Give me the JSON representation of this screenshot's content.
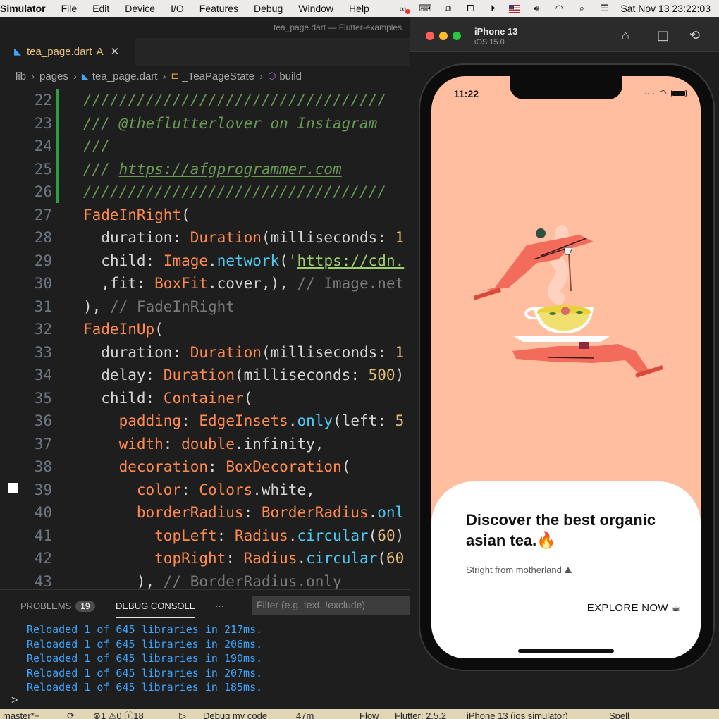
{
  "menubar": {
    "app": "Simulator",
    "menus": [
      "File",
      "Edit",
      "Device",
      "I/O",
      "Features",
      "Debug",
      "Window",
      "Help"
    ],
    "clock": "Sat Nov 13  23:22:03"
  },
  "vscode": {
    "window_title": "tea_page.dart — Flutter-examples",
    "tab": {
      "name": "tea_page.dart",
      "modifier": "A"
    },
    "breadcrumb": [
      "lib",
      "pages",
      "tea_page.dart",
      "_TeaPageState",
      "build"
    ],
    "line_numbers": [
      "22",
      "23",
      "24",
      "25",
      "26",
      "27",
      "28",
      "29",
      "30",
      "31",
      "32",
      "33",
      "34",
      "35",
      "36",
      "37",
      "38",
      "39",
      "40",
      "41",
      "42",
      "43"
    ],
    "panel": {
      "tabs": [
        "PROBLEMS",
        "DEBUG CONSOLE"
      ],
      "problems_count": "19",
      "more": "···",
      "filter_placeholder": "Filter (e.g. text, !exclude)",
      "console_lines": [
        "Reloaded 1 of 645 libraries in 217ms.",
        "Reloaded 1 of 645 libraries in 206ms.",
        "Reloaded 1 of 645 libraries in 190ms.",
        "Reloaded 1 of 645 libraries in 207ms.",
        "Reloaded 1 of 645 libraries in 185ms."
      ],
      "prompt": ">"
    },
    "status": {
      "branch": "master*+",
      "problems": "⊗1 ⚠0 ⓘ18",
      "debug": "Debug my code",
      "time": "47m",
      "flow": "Flow",
      "flutter": "Flutter: 2.5.2",
      "device": "iPhone 13 (ios simulator)",
      "spell": "Spell"
    }
  },
  "simulator": {
    "device_name": "iPhone 13",
    "os": "iOS 15.0",
    "phone": {
      "time": "11:22",
      "card_title": "Discover the best organic asian tea.🔥",
      "card_subtitle": "Stright from motherland ⛰",
      "explore_button": "EXPLORE NOW ☕"
    }
  },
  "colors": {
    "screen_bg": "#ffbea0",
    "comment": "#6a9955",
    "class": "#ff8a50",
    "method": "#4ec9f0",
    "number": "#e5c07b",
    "console": "#3ea6ff"
  }
}
